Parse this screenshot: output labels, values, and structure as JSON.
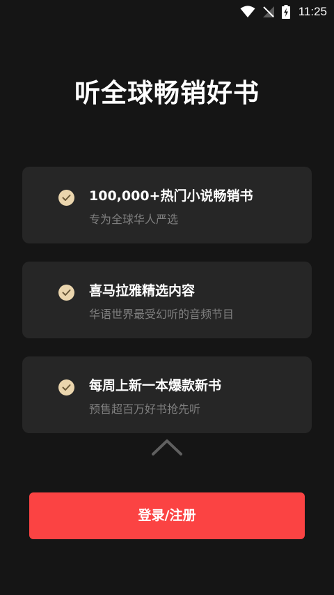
{
  "status_bar": {
    "time": "11:25",
    "icons": [
      "wifi-icon",
      "no-signal-icon",
      "battery-charging-icon"
    ]
  },
  "title": "听全球畅销好书",
  "features": [
    {
      "icon": "check-circle-icon",
      "title": "100,000+热门小说畅销书",
      "subtitle": "专为全球华人严选"
    },
    {
      "icon": "check-circle-icon",
      "title": "喜马拉雅精选内容",
      "subtitle": "华语世界最受幻听的音频节目"
    },
    {
      "icon": "check-circle-icon",
      "title": "每周上新一本爆款新书",
      "subtitle": "预售超百万好书抢先听"
    }
  ],
  "collapse_handle": {
    "icon": "chevron-up-icon"
  },
  "login_button": {
    "label": "登录/注册"
  },
  "colors": {
    "background": "#151515",
    "card_background": "#262626",
    "check_badge": "#ead5ad",
    "check_mark": "#6b5a3a",
    "subtitle_text": "#7f7f7f",
    "primary_button": "#fb4343"
  }
}
